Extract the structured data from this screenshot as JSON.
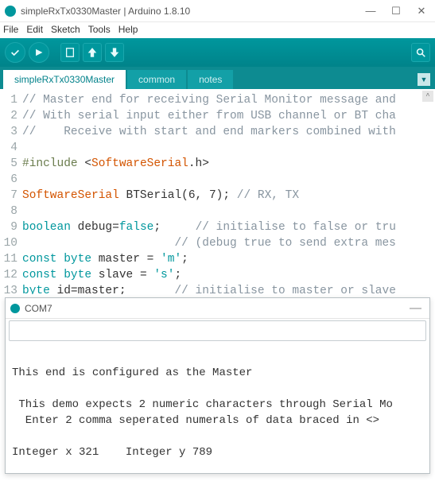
{
  "window": {
    "title": "simpleRxTx0330Master | Arduino 1.8.10"
  },
  "menus": {
    "file": "File",
    "edit": "Edit",
    "sketch": "Sketch",
    "tools": "Tools",
    "help": "Help"
  },
  "tabs": {
    "active": "simpleRxTx0330Master",
    "t1": "common",
    "t2": "notes"
  },
  "code": {
    "l1": "// Master end for receiving Serial Monitor message and",
    "l2": "// With serial input either from USB channel or BT cha",
    "l3": "//    Receive with start and end markers combined with",
    "l4": "",
    "l5a": "#include",
    "l5b": " <",
    "l5c": "SoftwareSerial",
    "l5d": ".h>",
    "l6": "",
    "l7a": "SoftwareSerial",
    "l7b": " BTSerial(6, 7); ",
    "l7c": "// RX, TX",
    "l8": "",
    "l9a": "boolean",
    "l9b": " debug=",
    "l9c": "false",
    "l9d": ";     ",
    "l9e": "// initialise to false or tru",
    "l10a": "                      ",
    "l10b": "// (debug true to send extra mes",
    "l11a": "const",
    "l11b": " byte",
    "l11c": " master = ",
    "l11d": "'m'",
    "l11e": ";",
    "l12a": "const",
    "l12b": " byte",
    "l12c": " slave = ",
    "l12d": "'s'",
    "l12e": ";",
    "l13a": "byte",
    "l13b": " id=master;       ",
    "l13c": "// initialise to master or slave"
  },
  "serial": {
    "title": "COM7",
    "line1": "This end is configured as the Master",
    "line2": "",
    "line3": " This demo expects 2 numeric characters through Serial Mo",
    "line4": "  Enter 2 comma seperated numerals of data braced in <>",
    "line5": "",
    "line6": "Integer x 321    Integer y 789"
  }
}
